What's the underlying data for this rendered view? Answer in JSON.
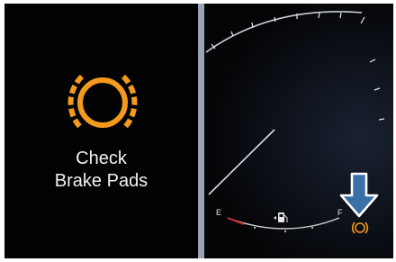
{
  "message": {
    "line1": "Check",
    "line2": "Brake Pads"
  },
  "fuel_gauge": {
    "empty_label": "E",
    "full_label": "F",
    "icon": "fuel-pump-icon"
  },
  "warning_icon": "brake-pad-warning-icon",
  "pointer_icon": "down-arrow-icon",
  "colors": {
    "warning_amber": "#f39a1e",
    "background": "#020202",
    "divider": "#9aa3b3",
    "low_fuel_red": "#c62828"
  }
}
